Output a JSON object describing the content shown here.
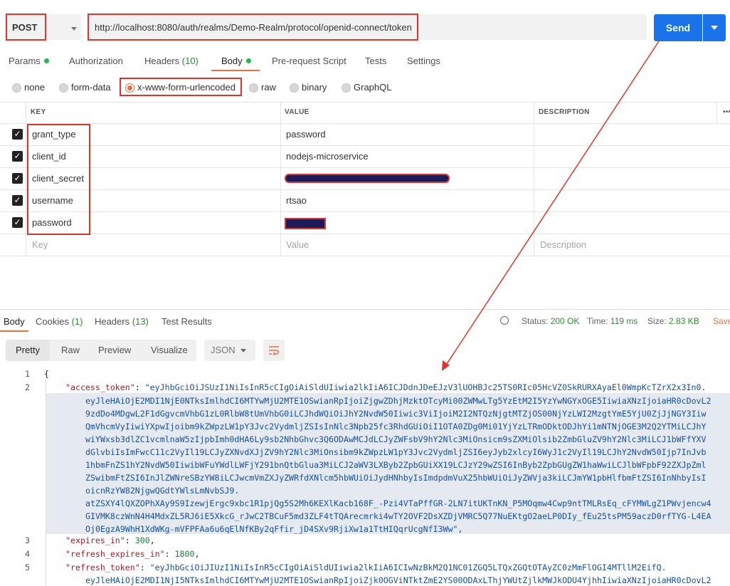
{
  "request": {
    "method": "POST",
    "url": "http://localhost:8080/auth/realms/Demo-Realm/protocol/openid-connect/token",
    "send_label": "Send"
  },
  "tabs": {
    "params": "Params",
    "authorization": "Authorization",
    "headers": "Headers",
    "headers_count": "(10)",
    "body": "Body",
    "pre_request": "Pre-request Script",
    "tests": "Tests",
    "settings": "Settings"
  },
  "body_types": {
    "none": "none",
    "form_data": "form-data",
    "urlencoded": "x-www-form-urlencoded",
    "raw": "raw",
    "binary": "binary",
    "graphql": "GraphQL"
  },
  "table": {
    "headers": {
      "key": "KEY",
      "value": "VALUE",
      "description": "DESCRIPTION",
      "more": "•••"
    },
    "rows": [
      {
        "key": "grant_type",
        "value": "password"
      },
      {
        "key": "client_id",
        "value": "nodejs-microservice"
      },
      {
        "key": "client_secret",
        "value": ""
      },
      {
        "key": "username",
        "value": "rtsao"
      },
      {
        "key": "password",
        "value": ""
      }
    ],
    "placeholder": {
      "key": "Key",
      "value": "Value",
      "description": "Description"
    }
  },
  "response": {
    "tabs": {
      "body": "Body",
      "cookies": "Cookies",
      "cookies_count": "(1)",
      "headers": "Headers",
      "headers_count": "(13)",
      "test_results": "Test Results"
    },
    "status_label": "Status:",
    "status_value": "200 OK",
    "time_label": "Time:",
    "time_value": "119 ms",
    "size_label": "Size:",
    "size_value": "2.83 KB",
    "save_label": "Save",
    "view_tabs": {
      "pretty": "Pretty",
      "raw": "Raw",
      "preview": "Preview",
      "visualize": "Visualize"
    },
    "format": "JSON",
    "line_numbers": [
      "1",
      "2",
      "3",
      "4",
      "5"
    ],
    "code": {
      "open_brace": "{",
      "access_token_key": "\"access_token\"",
      "access_token_lines": [
        "\"eyJhbGciOiJSUzI1NiIsInR5cCIgOiAiSldUIiwia2lkIiA6ICJDdnJDeEJzV3lUOHBJc25TS0RIc05HcVZ0SkRURXAyaEl0WmpKcTZrX2x3In0.",
        "eyJleHAiOjE2MDI1NjE0NTksImlhdCI6MTYwMjU2MTE1OSwianRpIjoiZjgwZDhjMzktOTcyMi00ZWMwLTg5YzEtM2I5YzYwNGYxOGE5IiwiaXNzIjoiaHR0cDovL2",
        "9zdDo4MDgwL2F1dGgvcmVhbG1zL0RlbW8tUmVhbG0iLCJhdWQiOiJhY2NvdW50Iiwic3ViIjoiM2I2NTQzNjgtMTZjOS00NjYzLWI2MzgtYmE5YjU0ZjJjNGY3Iiw",
        "QmVhcmVyIiwiYXpwIjoibm9kZWpzLW1pY3Jvc2VydmljZSIsInNlc3Npb25fc3RhdGUiOiI1OTA0ZDg0Mi01YjYzLTRmODktODJhYi1mNTNjOGE3M2Q2YTMiLCJhY",
        "wiYWxsb3dlZC1vcmlnaW5zIjpbImh0dHA6Ly9sb2NhbGhvc3Q6ODAwMCJdLCJyZWFsbV9hY2Nlc3MiOnsicm9sZXMiOlsib2ZmbGluZV9hY2Nlc3MiLCJ1bWFfYXV",
        "dGlvbiIsImFwcC11c2VyIl19LCJyZXNvdXJjZV9hY2Nlc3MiOnsibm9kZWpzLW1pY3Jvc2VydmljZSI6eyJyb2xlcyI6WyJ1c2VyIl19LCJhY2NvdW50Ijp7InJvb",
        "1hbmFnZS1hY2NvdW50IiwibWFuYWdlLWFjY291bnQtbGlua3MiLCJ2aWV3LXByb2ZpbGUiXX19LCJzY29wZSI6InByb2ZpbGUgZW1haWwiLCJlbWFpbF92ZXJpZml",
        "ZSwibmFtZSI6InJlZWNreSBzYW8iLCJwcmVmZXJyZWRfdXNlcm5hbWUiOiJydHNhbyIsImdpdmVuX25hbWUiOiJyZWVja3kiLCJmYW1pbHlfbmFtZSI6InNhbyIsI",
        "oicnRzYW82NjgwQGdtYWlsLmNvbSJ9.",
        "atZSXY4lQXZOPhXAy9S9IzewjErgc9xbc1R1pjQg5S2Mh6KEXlKacb168F_-Pzi4VTaPffGR-2LN7itUKTnKN_P5MOqmw4Cwp9ntTMLRsEq_cFYMWLgZ1PWvjencw4",
        "GIVMK8czWnN4H4MdxZL5RJ6iE5XkcG_rJwC2TBCuF5md3ZLF4tTQArecmrki4wTY2OVF2DsXZDjVMRC5Q77NuEKtgO2aeLP0DIy_fEu25tsPM59aczD0rfTYG-L4EA",
        "Oj0EgzA9WhH1XdWKg-mVFPFAa6u6qElNfKBy2qFfir_jD4SXv9RjiXw1a1TtHIQqrUcgNfI3Ww\","
      ],
      "expires_in_key": "\"expires_in\"",
      "expires_in_value": "300",
      "refresh_expires_in_key": "\"refresh_expires_in\"",
      "refresh_expires_in_value": "1800",
      "refresh_token_key": "\"refresh_token\"",
      "refresh_token_lines": [
        "\"eyJhbGciOiJIUzI1NiIsInR5cCIgOiAiSldUIiwia2lkIiA6ICIwNzBkM2Q1NC01ZGQ5LTQxZGQtOTAyZC0zMmFlOGI4MTllM2EifQ.",
        "eyJleHAiOjE2MDI1NjI5NTksImlhdCI6MTYwMjU2MTE1OSwianRpIjoiZjk0OGViNTktZmE2YS00ODAxLThjYWUtZjlkMWJkODU4YjhhIiwiaXNzIjoiaHR0cDovL2"
      ]
    }
  }
}
